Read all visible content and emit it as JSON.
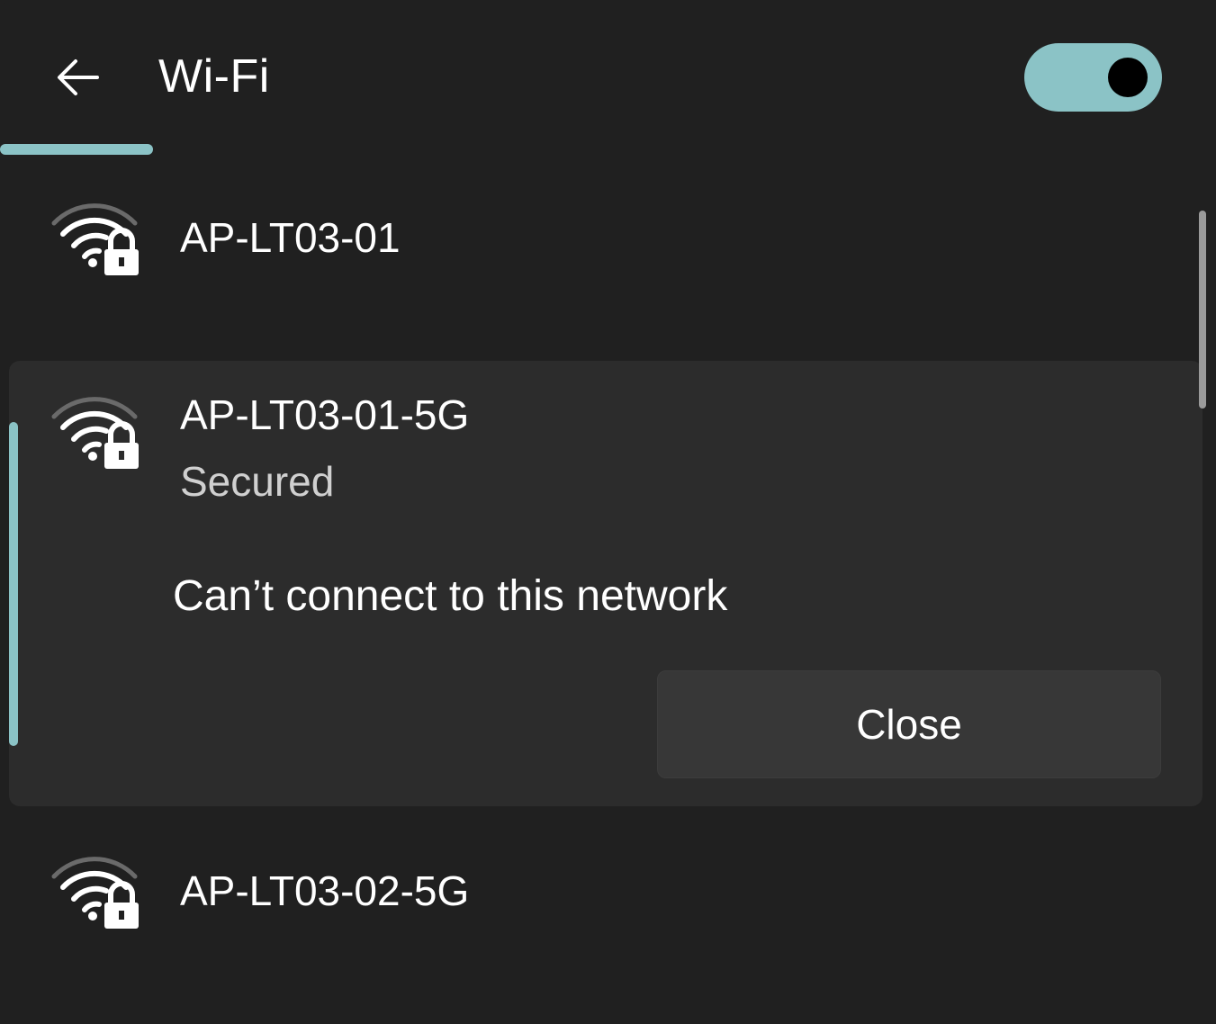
{
  "header": {
    "title": "Wi-Fi",
    "back_icon": "arrow-left-icon",
    "toggle_on": true
  },
  "colors": {
    "accent": "#8bc3c6",
    "background": "#202020",
    "expanded_background": "#2c2c2c"
  },
  "networks": [
    {
      "name": "AP-LT03-01",
      "icon": "wifi-secured-icon"
    },
    {
      "name": "AP-LT03-01-5G",
      "icon": "wifi-secured-icon",
      "status": "Secured",
      "error": "Can’t connect to this network",
      "close_label": "Close",
      "expanded": true
    },
    {
      "name": "AP-LT03-02-5G",
      "icon": "wifi-secured-icon"
    }
  ]
}
